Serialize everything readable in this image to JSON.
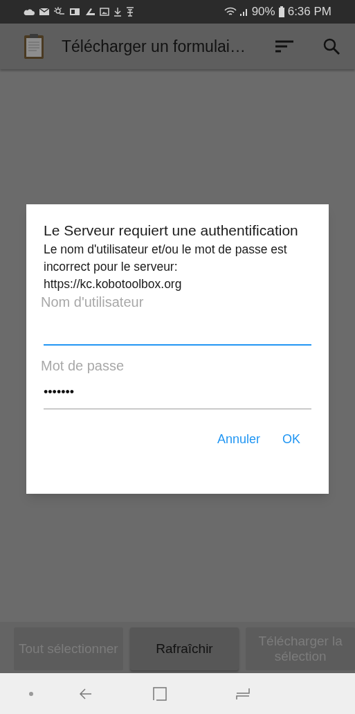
{
  "status_bar": {
    "battery_text": "90%",
    "time": "6:36 PM"
  },
  "app_bar": {
    "title": "Télécharger un formulai…"
  },
  "dialog": {
    "title": "Le Serveur requiert une authentification",
    "message": "Le nom d'utilisateur et/ou le mot de passe est incorrect pour le serveur: https://kc.kobotoolbox.org",
    "fields": [
      {
        "label": "Nom d'utilisateur",
        "focused": true
      },
      {
        "label": "Mot de passe",
        "value": "•••••••",
        "focused": false
      }
    ],
    "buttons": [
      "Annuler",
      "OK"
    ]
  },
  "bottom_buttons": [
    {
      "label": "Tout sélectionner",
      "disabled": true
    },
    {
      "label": "Rafraîchir",
      "disabled": false
    },
    {
      "label": "Télécharger la sélection",
      "disabled": true
    }
  ]
}
